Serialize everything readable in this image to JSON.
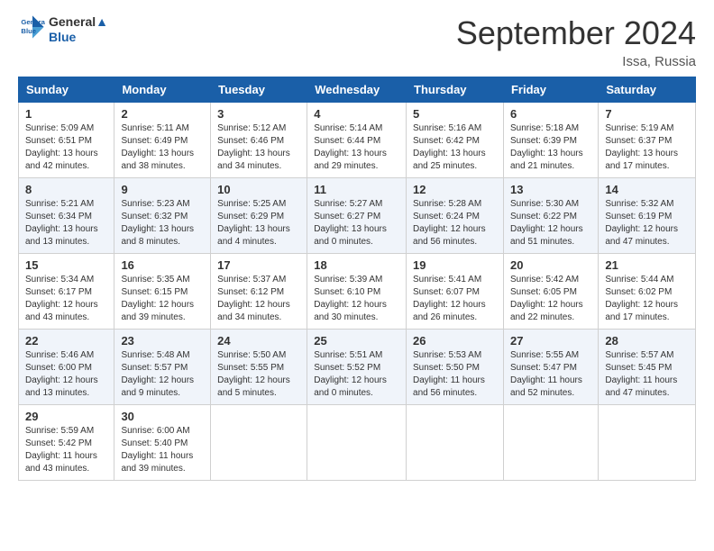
{
  "header": {
    "logo_line1": "General",
    "logo_line2": "Blue",
    "month": "September 2024",
    "location": "Issa, Russia"
  },
  "weekdays": [
    "Sunday",
    "Monday",
    "Tuesday",
    "Wednesday",
    "Thursday",
    "Friday",
    "Saturday"
  ],
  "weeks": [
    [
      {
        "day": "1",
        "info": "Sunrise: 5:09 AM\nSunset: 6:51 PM\nDaylight: 13 hours\nand 42 minutes."
      },
      {
        "day": "2",
        "info": "Sunrise: 5:11 AM\nSunset: 6:49 PM\nDaylight: 13 hours\nand 38 minutes."
      },
      {
        "day": "3",
        "info": "Sunrise: 5:12 AM\nSunset: 6:46 PM\nDaylight: 13 hours\nand 34 minutes."
      },
      {
        "day": "4",
        "info": "Sunrise: 5:14 AM\nSunset: 6:44 PM\nDaylight: 13 hours\nand 29 minutes."
      },
      {
        "day": "5",
        "info": "Sunrise: 5:16 AM\nSunset: 6:42 PM\nDaylight: 13 hours\nand 25 minutes."
      },
      {
        "day": "6",
        "info": "Sunrise: 5:18 AM\nSunset: 6:39 PM\nDaylight: 13 hours\nand 21 minutes."
      },
      {
        "day": "7",
        "info": "Sunrise: 5:19 AM\nSunset: 6:37 PM\nDaylight: 13 hours\nand 17 minutes."
      }
    ],
    [
      {
        "day": "8",
        "info": "Sunrise: 5:21 AM\nSunset: 6:34 PM\nDaylight: 13 hours\nand 13 minutes."
      },
      {
        "day": "9",
        "info": "Sunrise: 5:23 AM\nSunset: 6:32 PM\nDaylight: 13 hours\nand 8 minutes."
      },
      {
        "day": "10",
        "info": "Sunrise: 5:25 AM\nSunset: 6:29 PM\nDaylight: 13 hours\nand 4 minutes."
      },
      {
        "day": "11",
        "info": "Sunrise: 5:27 AM\nSunset: 6:27 PM\nDaylight: 13 hours\nand 0 minutes."
      },
      {
        "day": "12",
        "info": "Sunrise: 5:28 AM\nSunset: 6:24 PM\nDaylight: 12 hours\nand 56 minutes."
      },
      {
        "day": "13",
        "info": "Sunrise: 5:30 AM\nSunset: 6:22 PM\nDaylight: 12 hours\nand 51 minutes."
      },
      {
        "day": "14",
        "info": "Sunrise: 5:32 AM\nSunset: 6:19 PM\nDaylight: 12 hours\nand 47 minutes."
      }
    ],
    [
      {
        "day": "15",
        "info": "Sunrise: 5:34 AM\nSunset: 6:17 PM\nDaylight: 12 hours\nand 43 minutes."
      },
      {
        "day": "16",
        "info": "Sunrise: 5:35 AM\nSunset: 6:15 PM\nDaylight: 12 hours\nand 39 minutes."
      },
      {
        "day": "17",
        "info": "Sunrise: 5:37 AM\nSunset: 6:12 PM\nDaylight: 12 hours\nand 34 minutes."
      },
      {
        "day": "18",
        "info": "Sunrise: 5:39 AM\nSunset: 6:10 PM\nDaylight: 12 hours\nand 30 minutes."
      },
      {
        "day": "19",
        "info": "Sunrise: 5:41 AM\nSunset: 6:07 PM\nDaylight: 12 hours\nand 26 minutes."
      },
      {
        "day": "20",
        "info": "Sunrise: 5:42 AM\nSunset: 6:05 PM\nDaylight: 12 hours\nand 22 minutes."
      },
      {
        "day": "21",
        "info": "Sunrise: 5:44 AM\nSunset: 6:02 PM\nDaylight: 12 hours\nand 17 minutes."
      }
    ],
    [
      {
        "day": "22",
        "info": "Sunrise: 5:46 AM\nSunset: 6:00 PM\nDaylight: 12 hours\nand 13 minutes."
      },
      {
        "day": "23",
        "info": "Sunrise: 5:48 AM\nSunset: 5:57 PM\nDaylight: 12 hours\nand 9 minutes."
      },
      {
        "day": "24",
        "info": "Sunrise: 5:50 AM\nSunset: 5:55 PM\nDaylight: 12 hours\nand 5 minutes."
      },
      {
        "day": "25",
        "info": "Sunrise: 5:51 AM\nSunset: 5:52 PM\nDaylight: 12 hours\nand 0 minutes."
      },
      {
        "day": "26",
        "info": "Sunrise: 5:53 AM\nSunset: 5:50 PM\nDaylight: 11 hours\nand 56 minutes."
      },
      {
        "day": "27",
        "info": "Sunrise: 5:55 AM\nSunset: 5:47 PM\nDaylight: 11 hours\nand 52 minutes."
      },
      {
        "day": "28",
        "info": "Sunrise: 5:57 AM\nSunset: 5:45 PM\nDaylight: 11 hours\nand 47 minutes."
      }
    ],
    [
      {
        "day": "29",
        "info": "Sunrise: 5:59 AM\nSunset: 5:42 PM\nDaylight: 11 hours\nand 43 minutes."
      },
      {
        "day": "30",
        "info": "Sunrise: 6:00 AM\nSunset: 5:40 PM\nDaylight: 11 hours\nand 39 minutes."
      },
      {
        "day": "",
        "info": ""
      },
      {
        "day": "",
        "info": ""
      },
      {
        "day": "",
        "info": ""
      },
      {
        "day": "",
        "info": ""
      },
      {
        "day": "",
        "info": ""
      }
    ]
  ]
}
